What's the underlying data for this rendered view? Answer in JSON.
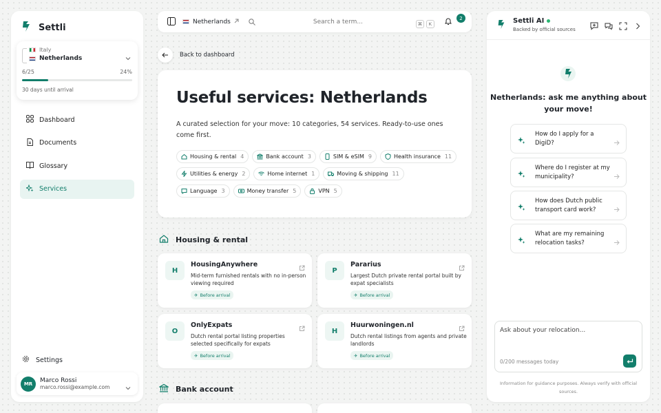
{
  "colors": {
    "accent": "#127e6b",
    "accent_light": "#e8f4f1",
    "online": "#2bb673"
  },
  "sidebar": {
    "brand": "Settli",
    "move": {
      "from": "Italy",
      "to": "Netherlands",
      "progress_label": "6/25",
      "progress_percent": "24%",
      "progress_value": 0.24,
      "days_label": "30 days until arrival"
    },
    "nav": [
      {
        "label": "Dashboard",
        "icon": "grid-icon"
      },
      {
        "label": "Documents",
        "icon": "document-icon"
      },
      {
        "label": "Glossary",
        "icon": "book-icon"
      },
      {
        "label": "Services",
        "icon": "sparkle-icon",
        "active": true
      }
    ],
    "settings_label": "Settings",
    "user": {
      "initials": "MR",
      "name": "Marco Rossi",
      "email": "marco.rossi@example.com"
    }
  },
  "topbar": {
    "country": "Netherlands",
    "search_placeholder": "Search a term...",
    "kbd": [
      "⌘",
      "K"
    ],
    "notifications": "2"
  },
  "main": {
    "back_label": "Back to dashboard",
    "title": "Useful services: Netherlands",
    "description": "A curated selection for your move: 10 categories, 54 services. Ready-to-use ones come first.",
    "chips": [
      {
        "label": "Housing & rental",
        "count": "4",
        "icon": "home-icon"
      },
      {
        "label": "Bank account",
        "count": "3",
        "icon": "bank-icon"
      },
      {
        "label": "SIM & eSIM",
        "count": "9",
        "icon": "sim-icon"
      },
      {
        "label": "Health insurance",
        "count": "11",
        "icon": "shield-icon"
      },
      {
        "label": "Utilities & energy",
        "count": "2",
        "icon": "bolt-icon"
      },
      {
        "label": "Home internet",
        "count": "1",
        "icon": "wifi-icon"
      },
      {
        "label": "Moving & shipping",
        "count": "11",
        "icon": "truck-icon"
      },
      {
        "label": "Language",
        "count": "3",
        "icon": "language-icon"
      },
      {
        "label": "Money transfer",
        "count": "5",
        "icon": "money-icon"
      },
      {
        "label": "VPN",
        "count": "5",
        "icon": "lock-icon"
      }
    ],
    "sections": [
      {
        "title": "Housing & rental",
        "services": [
          {
            "logo": "H",
            "name": "HousingAnywhere",
            "description": "Mid-term furnished rentals with no in-person viewing required",
            "tag": "Before arrival"
          },
          {
            "logo": "P",
            "name": "Pararius",
            "description": "Largest Dutch private rental portal built by expat specialists",
            "tag": "Before arrival"
          },
          {
            "logo": "O",
            "name": "OnlyExpats",
            "description": "Dutch rental portal listing properties selected specifically for expats",
            "tag": "Before arrival"
          },
          {
            "logo": "H",
            "name": "Huurwoningen.nl",
            "description": "Dutch rental listings from agents and private landlords",
            "tag": "Before arrival"
          }
        ]
      },
      {
        "title": "Bank account"
      }
    ]
  },
  "assistant": {
    "title": "Settli AI",
    "subtitle": "Backed by official sources",
    "welcome": "Netherlands: ask me anything about your move!",
    "suggestions": [
      "How do I apply for a DigiD?",
      "Where do I register at my municipality?",
      "How does Dutch public transport card work?",
      "What are my remaining relocation tasks?"
    ],
    "input_placeholder": "Ask about your relocation...",
    "message_count": "0/200 messages today",
    "disclaimer": "Information for guidance purposes. Always verify with official sources."
  }
}
